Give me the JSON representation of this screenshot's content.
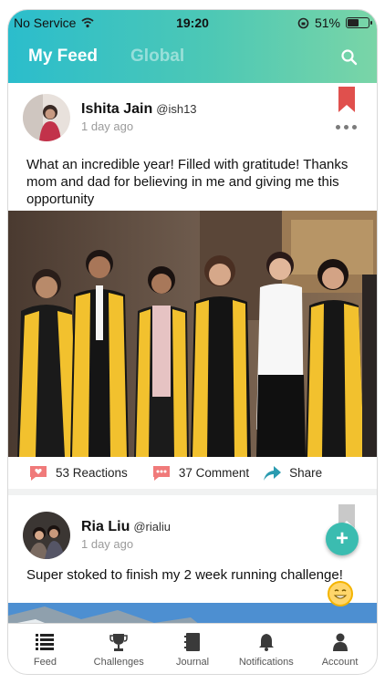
{
  "status": {
    "carrier": "No Service",
    "time": "19:20",
    "battery": "51%",
    "battery_level": 0.51
  },
  "header": {
    "tab_active": "My Feed",
    "tab_inactive": "Global"
  },
  "posts": [
    {
      "name": "Ishita Jain",
      "handle": "@ish13",
      "time": "1 day ago",
      "text": "What an incredible year! Filled with gratitude! Thanks mom and dad for believing in me and giving me this opportunity",
      "reactions": "53 Reactions",
      "comments": "37 Comment",
      "share": "Share",
      "bookmark_color": "#e0504d"
    },
    {
      "name": "Ria Liu",
      "handle": "@rialiu",
      "time": "1 day ago",
      "text": "Super stoked to finish my 2 week running challenge!",
      "bookmark_color": "#c9c9c9"
    }
  ],
  "nav": {
    "feed": "Feed",
    "challenges": "Challenges",
    "journal": "Journal",
    "notifications": "Notifications",
    "account": "Account"
  },
  "colors": {
    "accent": "#3bbcb0",
    "reaction": "#f07a7a",
    "share": "#2a9bb0"
  }
}
